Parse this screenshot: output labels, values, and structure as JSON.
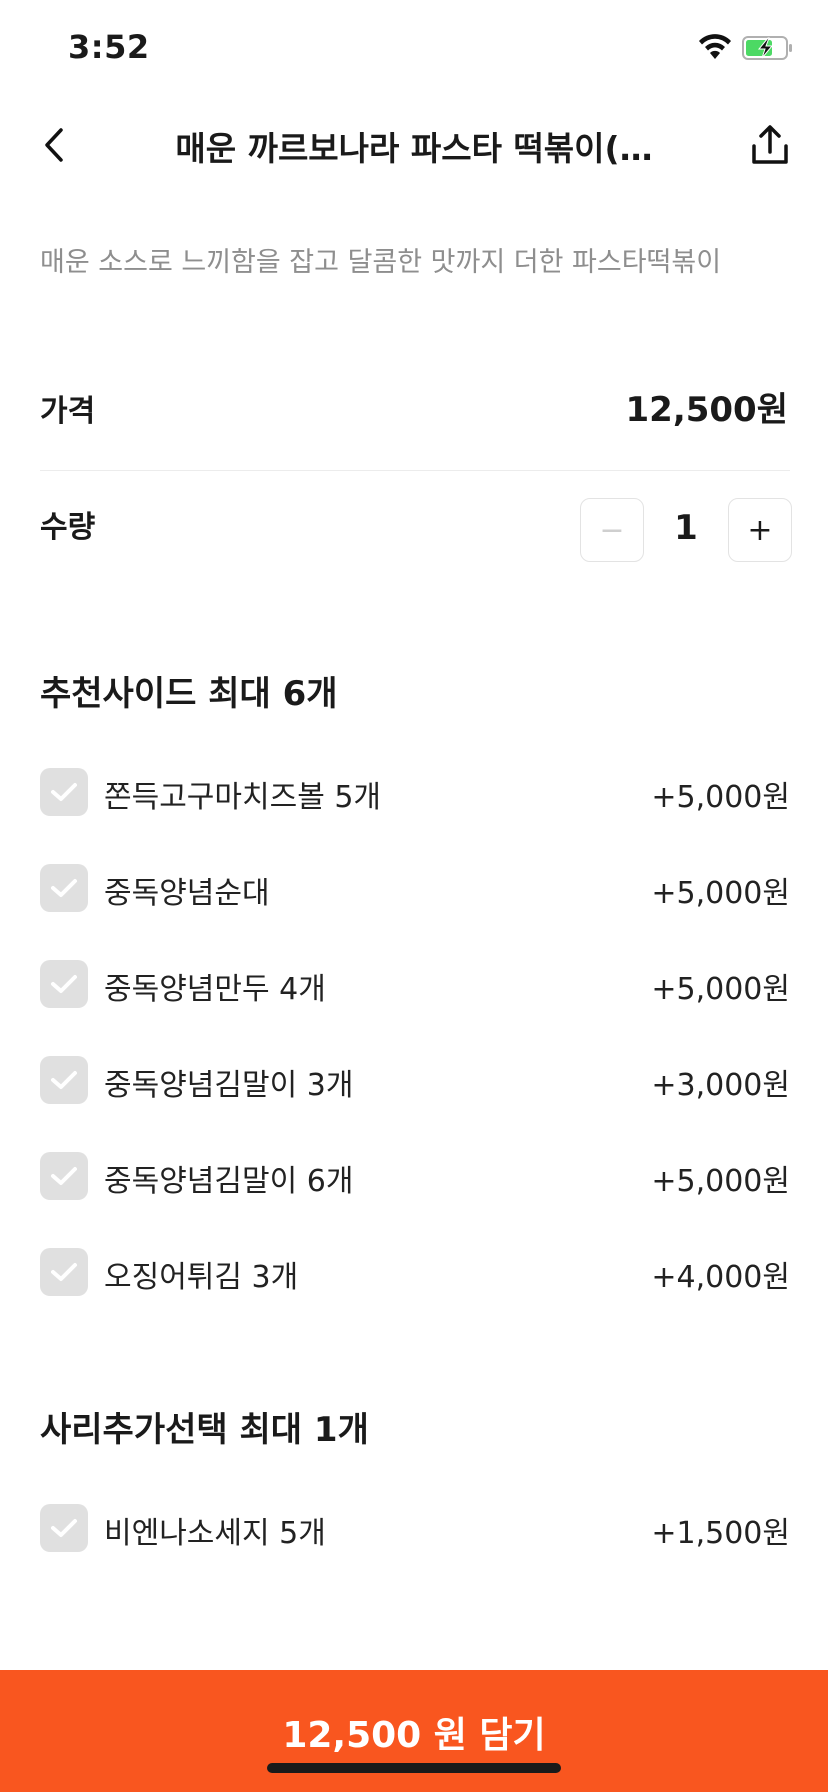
{
  "status_bar": {
    "time": "3:52",
    "wifi_icon": "wifi-icon",
    "battery_icon": "battery-charging-icon",
    "battery_color": "#4cd964"
  },
  "nav": {
    "back_icon": "chevron-left-icon",
    "title": "매운 까르보나라 파스타 떡볶이(…",
    "share_icon": "share-icon"
  },
  "description": "매운 소스로 느끼함을 잡고 달콤한 맛까지 더한 파스타떡볶이",
  "price": {
    "label": "가격",
    "value": "12,500원"
  },
  "quantity": {
    "label": "수량",
    "value": "1",
    "minus_label": "−",
    "plus_label": "+"
  },
  "side_section": {
    "title": "추천사이드 최대 6개",
    "items": [
      {
        "name": "쫀득고구마치즈볼 5개",
        "price": "+5,000원"
      },
      {
        "name": "중독양념순대",
        "price": "+5,000원"
      },
      {
        "name": "중독양념만두 4개",
        "price": "+5,000원"
      },
      {
        "name": "중독양념김말이 3개",
        "price": "+3,000원"
      },
      {
        "name": "중독양념김말이 6개",
        "price": "+5,000원"
      },
      {
        "name": "오징어튀김 3개",
        "price": "+4,000원"
      }
    ]
  },
  "extra_section": {
    "title": "사리추가선택 최대 1개",
    "items": [
      {
        "name": "비엔나소세지 5개",
        "price": "+1,500원"
      }
    ]
  },
  "cart_button": {
    "label": "12,500 원 담기",
    "color": "#f9561f"
  }
}
